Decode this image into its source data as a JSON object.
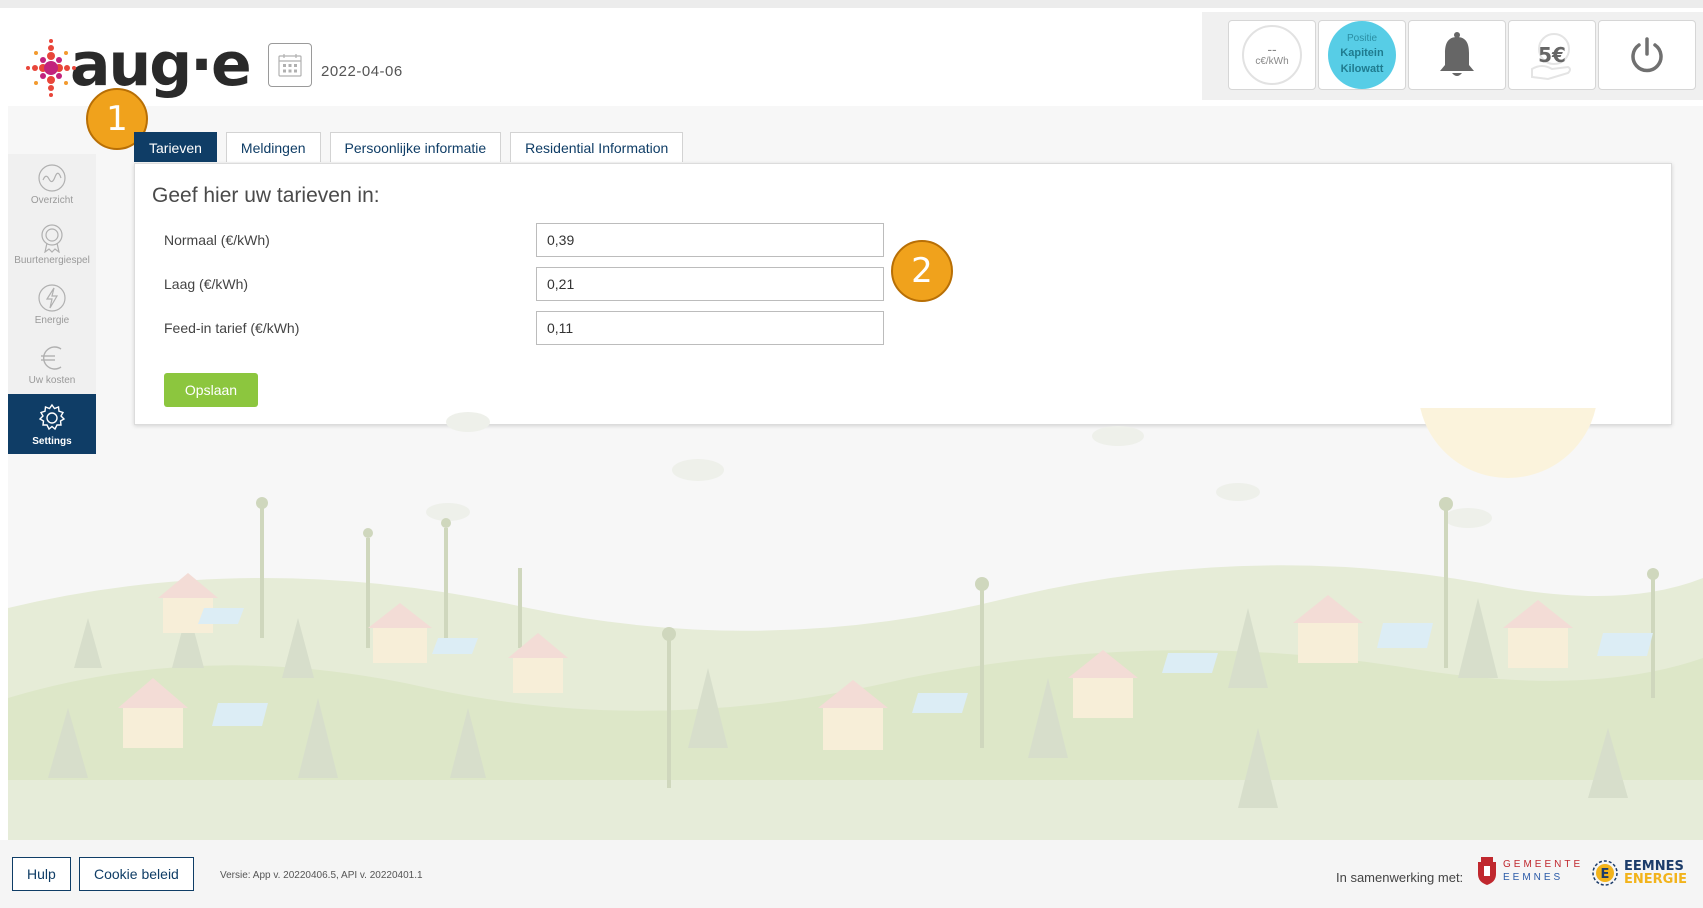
{
  "header": {
    "logo_text": "aug·e",
    "date": "2022-04-06",
    "price": {
      "value": "--",
      "unit": "c€/kWh"
    },
    "profile": {
      "line1": "Positie",
      "line2": "Kapitein",
      "line3": "Kilowatt"
    },
    "money_label": "5€"
  },
  "badges": {
    "b1": "1",
    "b2": "2"
  },
  "sidebar": {
    "items": [
      {
        "label": "Overzicht",
        "icon": "overview-icon"
      },
      {
        "label": "Buurtenergiespel",
        "icon": "award-icon"
      },
      {
        "label": "Energie",
        "icon": "lightning-icon"
      },
      {
        "label": "Uw kosten",
        "icon": "euro-icon"
      },
      {
        "label": "Settings",
        "icon": "gear-icon",
        "active": true
      }
    ]
  },
  "tabs": [
    {
      "label": "Tarieven",
      "active": true
    },
    {
      "label": "Meldingen"
    },
    {
      "label": "Persoonlijke informatie"
    },
    {
      "label": "Residential Information"
    }
  ],
  "form": {
    "title": "Geef hier uw tarieven in:",
    "fields": [
      {
        "label": "Normaal (€/kWh)",
        "value": "0,39"
      },
      {
        "label": "Laag (€/kWh)",
        "value": "0,21"
      },
      {
        "label": "Feed-in tarief (€/kWh)",
        "value": "0,11"
      }
    ],
    "save_label": "Opslaan"
  },
  "footer": {
    "help_label": "Hulp",
    "cookie_label": "Cookie beleid",
    "version": "Versie: App v. 20220406.5, API v. 20220401.1",
    "partners_label": "In samenwerking met:",
    "partner1": {
      "line1": "GEMEENTE",
      "line2": "EEMNES"
    },
    "partner2": {
      "line1": "EEMNES",
      "line2": "ENERGIE"
    }
  },
  "colors": {
    "navy": "#0f3d66",
    "green": "#8cc63e",
    "badge_orange": "#f0a21c",
    "avatar_cyan": "#57cde6"
  }
}
